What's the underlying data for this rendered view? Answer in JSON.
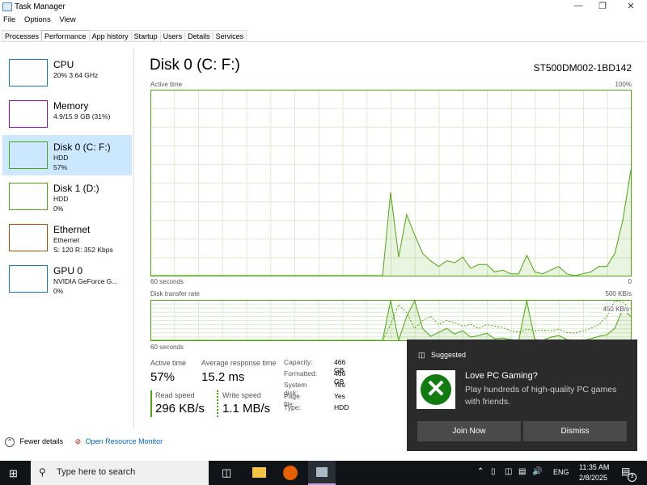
{
  "window": {
    "title": "Task Manager",
    "menu": [
      "File",
      "Options",
      "View"
    ],
    "tabs": [
      "Processes",
      "Performance",
      "App history",
      "Startup",
      "Users",
      "Details",
      "Services"
    ],
    "active_tab": 1
  },
  "sidebar": [
    {
      "name": "CPU",
      "sub1": "20%  3.64 GHz",
      "sub2": "",
      "color": "#117dbb"
    },
    {
      "name": "Memory",
      "sub1": "4.9/15.9 GB (31%)",
      "sub2": "",
      "color": "#8b12ae"
    },
    {
      "name": "Disk 0 (C: F:)",
      "sub1": "HDD",
      "sub2": "57%",
      "color": "#4da60c"
    },
    {
      "name": "Disk 1 (D:)",
      "sub1": "HDD",
      "sub2": "0%",
      "color": "#4da60c"
    },
    {
      "name": "Ethernet",
      "sub1": "Ethernet",
      "sub2": "S: 120  R: 352 Kbps",
      "color": "#a74f01"
    },
    {
      "name": "GPU 0",
      "sub1": "NVIDIA GeForce G...",
      "sub2": "0%",
      "color": "#117dbb"
    }
  ],
  "main": {
    "title": "Disk 0 (C: F:)",
    "model": "ST500DM002-1BD142",
    "active_graph": {
      "label": "Active time",
      "max_label": "100%",
      "left_label": "60 seconds",
      "right_label": "0",
      "values": [
        0,
        0,
        0,
        0,
        0,
        0,
        0,
        0,
        0,
        0,
        0,
        0,
        0,
        0,
        0,
        0,
        0,
        0,
        0,
        0,
        0,
        0,
        0,
        0,
        0,
        0,
        0,
        0,
        0,
        0,
        45,
        10,
        33,
        22,
        12,
        8,
        5,
        8,
        7,
        10,
        4,
        6,
        6,
        2,
        3,
        1,
        1,
        11,
        2,
        1,
        3,
        5,
        1,
        0,
        1,
        2,
        5,
        5,
        12,
        30,
        57
      ]
    },
    "transfer_graph": {
      "label": "Disk transfer rate",
      "max_label": "500 KB/s",
      "sec_label": "450 KB/s",
      "left_label": "60 seconds",
      "read_kbps": [
        0,
        0,
        0,
        0,
        0,
        0,
        0,
        0,
        0,
        0,
        0,
        0,
        0,
        0,
        0,
        0,
        0,
        0,
        0,
        0,
        0,
        0,
        0,
        0,
        0,
        0,
        0,
        0,
        0,
        0,
        500,
        0,
        300,
        500,
        150,
        50,
        100,
        150,
        80,
        120,
        40,
        60,
        90,
        20,
        30,
        10,
        0,
        500,
        10,
        0,
        40,
        60,
        10,
        0,
        0,
        20,
        50,
        70,
        150,
        400,
        300
      ],
      "write_kbps": [
        0,
        0,
        0,
        0,
        0,
        0,
        0,
        0,
        0,
        0,
        0,
        0,
        0,
        0,
        0,
        0,
        0,
        0,
        0,
        0,
        0,
        0,
        0,
        0,
        0,
        0,
        0,
        0,
        0,
        0,
        200,
        450,
        350,
        150,
        250,
        300,
        200,
        250,
        220,
        180,
        200,
        150,
        200,
        180,
        160,
        120,
        100,
        140,
        120,
        130,
        120,
        140,
        100,
        90,
        120,
        150,
        200,
        300,
        500,
        480,
        400
      ]
    },
    "stats": {
      "active_label": "Active time",
      "active": "57%",
      "resp_label": "Average response time",
      "resp": "15.2 ms",
      "read_label": "Read speed",
      "read": "296 KB/s",
      "write_label": "Write speed",
      "write": "1.1 MB/s"
    },
    "props": [
      [
        "Capacity:",
        "466 GB"
      ],
      [
        "Formatted:",
        "466 GB"
      ],
      [
        "System disk:",
        "Yes"
      ],
      [
        "Page file:",
        "Yes"
      ],
      [
        "Type:",
        "HDD"
      ]
    ]
  },
  "footer": {
    "fewer": "Fewer details",
    "monitor": "Open Resource Monitor"
  },
  "toast": {
    "header": "Suggested",
    "title": "Love PC Gaming?",
    "body": "Play hundreds of high-quality PC games with friends.",
    "join": "Join Now",
    "dismiss": "Dismiss"
  },
  "taskbar": {
    "search": "Type here to search",
    "lang": "ENG",
    "time": "11:35 AM",
    "date": "2/8/2025",
    "notifications": "3"
  },
  "colors": {
    "disk": "#4da60c",
    "selected": "#cce8ff",
    "link": "#0066cc"
  }
}
